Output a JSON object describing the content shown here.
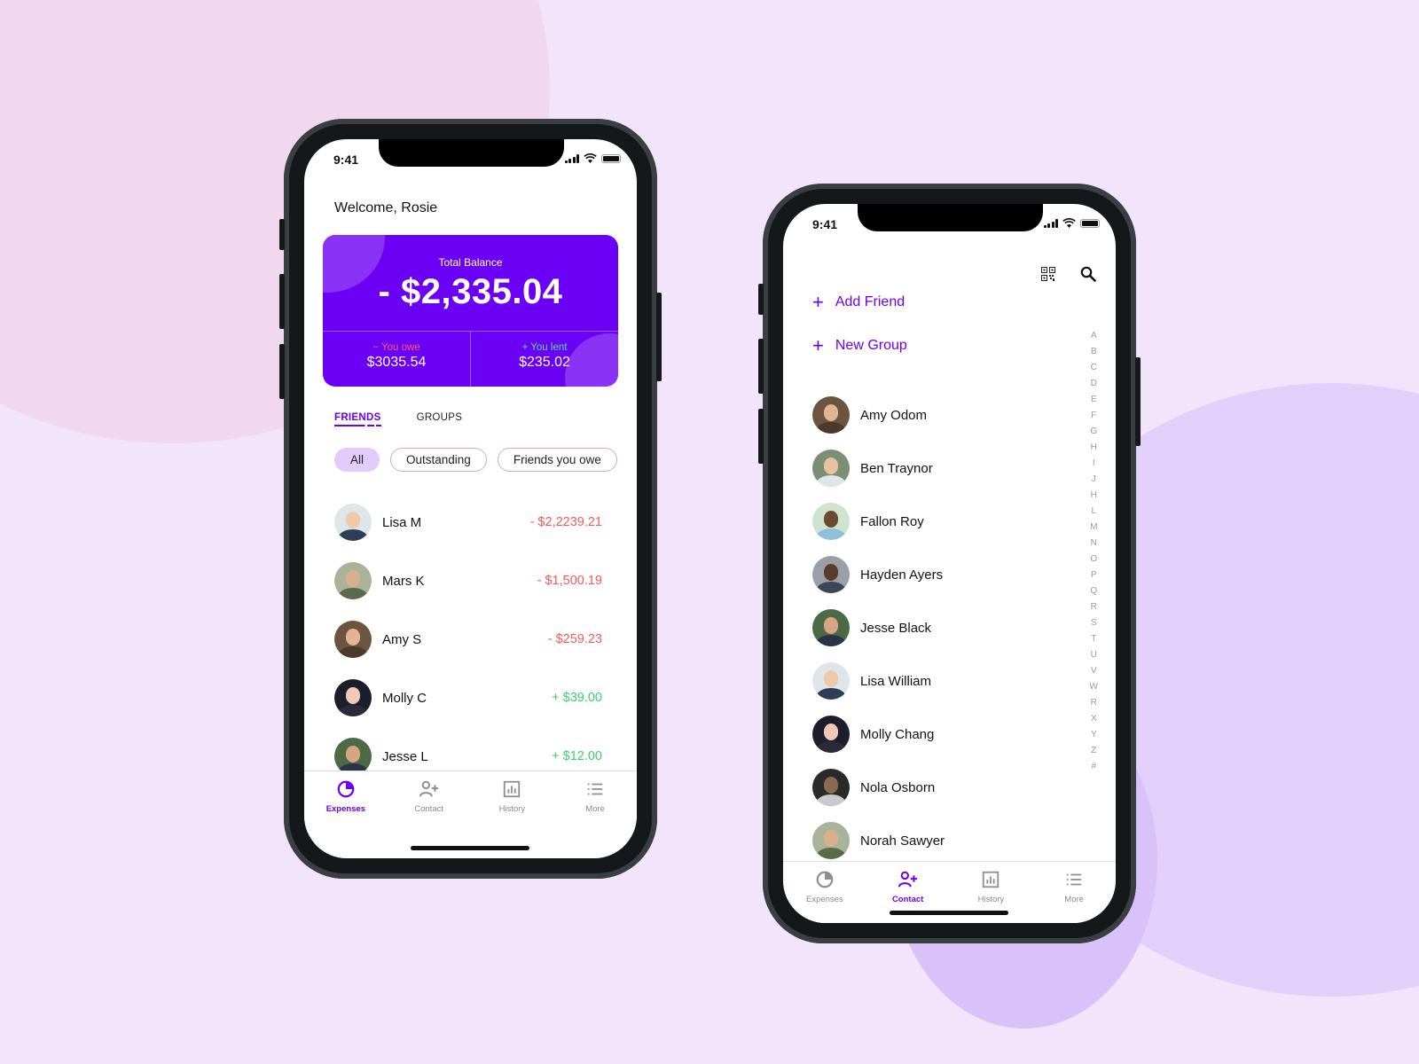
{
  "colors": {
    "accent": "#6a00f4",
    "negative": "#f65a5a",
    "positive": "#3ccf6a",
    "muted": "#8a8a8a"
  },
  "left_phone": {
    "status": {
      "time": "9:41"
    },
    "welcome": "Welcome, Rosie",
    "balance_card": {
      "label": "Total Balance",
      "value": "- $2,335.04",
      "owe": {
        "sign": "−",
        "label": "You owe",
        "amount": "$3035.54"
      },
      "lent": {
        "sign": "+",
        "label": "You lent",
        "amount": "$235.02"
      }
    },
    "tabs": [
      {
        "label": "FRIENDS",
        "active": true
      },
      {
        "label": "GROUPS",
        "active": false
      }
    ],
    "filters": [
      {
        "label": "All",
        "active": true
      },
      {
        "label": "Outstanding",
        "active": false
      },
      {
        "label": "Friends you owe",
        "active": false
      }
    ],
    "friends": [
      {
        "name": "Lisa M",
        "amount": "- $2,2239.21",
        "type": "neg"
      },
      {
        "name": "Mars K",
        "amount": "- $1,500.19",
        "type": "neg"
      },
      {
        "name": "Amy S",
        "amount": "- $259.23",
        "type": "neg"
      },
      {
        "name": "Molly C",
        "amount": "+ $39.00",
        "type": "pos"
      },
      {
        "name": "Jesse L",
        "amount": "+ $12.00",
        "type": "pos"
      }
    ],
    "tabbar": [
      {
        "label": "Expenses",
        "icon": "pie-chart-icon",
        "active": true
      },
      {
        "label": "Contact",
        "icon": "add-user-icon",
        "active": false
      },
      {
        "label": "History",
        "icon": "bar-chart-icon",
        "active": false
      },
      {
        "label": "More",
        "icon": "list-icon",
        "active": false
      }
    ]
  },
  "right_phone": {
    "status": {
      "time": "9:41"
    },
    "top_icons": [
      "qr-code-icon",
      "search-icon"
    ],
    "actions": [
      {
        "label": "Add Friend",
        "icon": "plus-icon"
      },
      {
        "label": "New Group",
        "icon": "plus-icon"
      }
    ],
    "contacts": [
      "Amy Odom",
      "Ben Traynor",
      "Fallon Roy",
      "Hayden Ayers",
      "Jesse Black",
      "Lisa William",
      "Molly Chang",
      "Nola Osborn",
      "Norah Sawyer"
    ],
    "alphabet_index": [
      "A",
      "B",
      "C",
      "D",
      "E",
      "F",
      "G",
      "H",
      "I",
      "J",
      "H",
      "L",
      "M",
      "N",
      "O",
      "P",
      "Q",
      "R",
      "S",
      "T",
      "U",
      "V",
      "W",
      "R",
      "X",
      "Y",
      "Z",
      "#"
    ],
    "tabbar": [
      {
        "label": "Expenses",
        "icon": "pie-chart-icon",
        "active": false
      },
      {
        "label": "Contact",
        "icon": "add-user-icon",
        "active": true
      },
      {
        "label": "History",
        "icon": "bar-chart-icon",
        "active": false
      },
      {
        "label": "More",
        "icon": "list-icon",
        "active": false
      }
    ]
  }
}
